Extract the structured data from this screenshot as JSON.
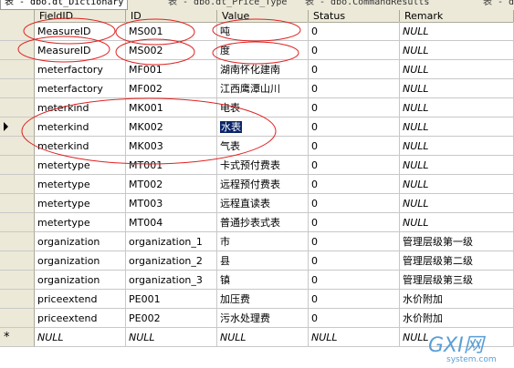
{
  "tabs": [
    {
      "label": "表 - dbo.dt_Dictionary",
      "active": true
    },
    {
      "label": "表 - dbo.dt_Price_Type",
      "active": false
    },
    {
      "label": "表 - dbo.CommandResults",
      "active": false
    },
    {
      "label": "表 - dbo",
      "active": false
    }
  ],
  "columns": [
    "FieldID",
    "ID",
    "Value",
    "Status",
    "Remark"
  ],
  "rows": [
    {
      "FieldID": "MeasureID",
      "ID": "MS001",
      "Value": "吨",
      "Status": "0",
      "Remark": "NULL"
    },
    {
      "FieldID": "MeasureID",
      "ID": "MS002",
      "Value": "度",
      "Status": "0",
      "Remark": "NULL"
    },
    {
      "FieldID": "meterfactory",
      "ID": "MF001",
      "Value": "湖南怀化建南",
      "Status": "0",
      "Remark": "NULL"
    },
    {
      "FieldID": "meterfactory",
      "ID": "MF002",
      "Value": "江西鹰潭山川",
      "Status": "0",
      "Remark": "NULL"
    },
    {
      "FieldID": "meterkind",
      "ID": "MK001",
      "Value": "电表",
      "Status": "0",
      "Remark": "NULL"
    },
    {
      "FieldID": "meterkind",
      "ID": "MK002",
      "Value": "水表",
      "Status": "0",
      "Remark": "NULL"
    },
    {
      "FieldID": "meterkind",
      "ID": "MK003",
      "Value": "气表",
      "Status": "0",
      "Remark": "NULL"
    },
    {
      "FieldID": "metertype",
      "ID": "MT001",
      "Value": "卡式预付费表",
      "Status": "0",
      "Remark": "NULL"
    },
    {
      "FieldID": "metertype",
      "ID": "MT002",
      "Value": "远程预付费表",
      "Status": "0",
      "Remark": "NULL"
    },
    {
      "FieldID": "metertype",
      "ID": "MT003",
      "Value": "远程直读表",
      "Status": "0",
      "Remark": "NULL"
    },
    {
      "FieldID": "metertype",
      "ID": "MT004",
      "Value": "普通抄表式表",
      "Status": "0",
      "Remark": "NULL"
    },
    {
      "FieldID": "organization",
      "ID": "organization_1",
      "Value": "市",
      "Status": "0",
      "Remark": "管理层级第一级"
    },
    {
      "FieldID": "organization",
      "ID": "organization_2",
      "Value": "县",
      "Status": "0",
      "Remark": "管理层级第二级"
    },
    {
      "FieldID": "organization",
      "ID": "organization_3",
      "Value": "镇",
      "Status": "0",
      "Remark": "管理层级第三级"
    },
    {
      "FieldID": "priceextend",
      "ID": "PE001",
      "Value": "加压费",
      "Status": "0",
      "Remark": "水价附加"
    },
    {
      "FieldID": "priceextend",
      "ID": "PE002",
      "Value": "污水处理费",
      "Status": "0",
      "Remark": "水价附加"
    }
  ],
  "new_row": {
    "FieldID": "NULL",
    "ID": "NULL",
    "Value": "NULL",
    "Status": "NULL",
    "Remark": "NULL"
  },
  "selected_row_index": 5,
  "new_row_marker": "*",
  "watermark": {
    "brand": "GXI网",
    "domain": "system.com"
  },
  "colors": {
    "annotation": "#e02020",
    "selection": "#0a246a",
    "header_bg": "#ece9d8"
  }
}
